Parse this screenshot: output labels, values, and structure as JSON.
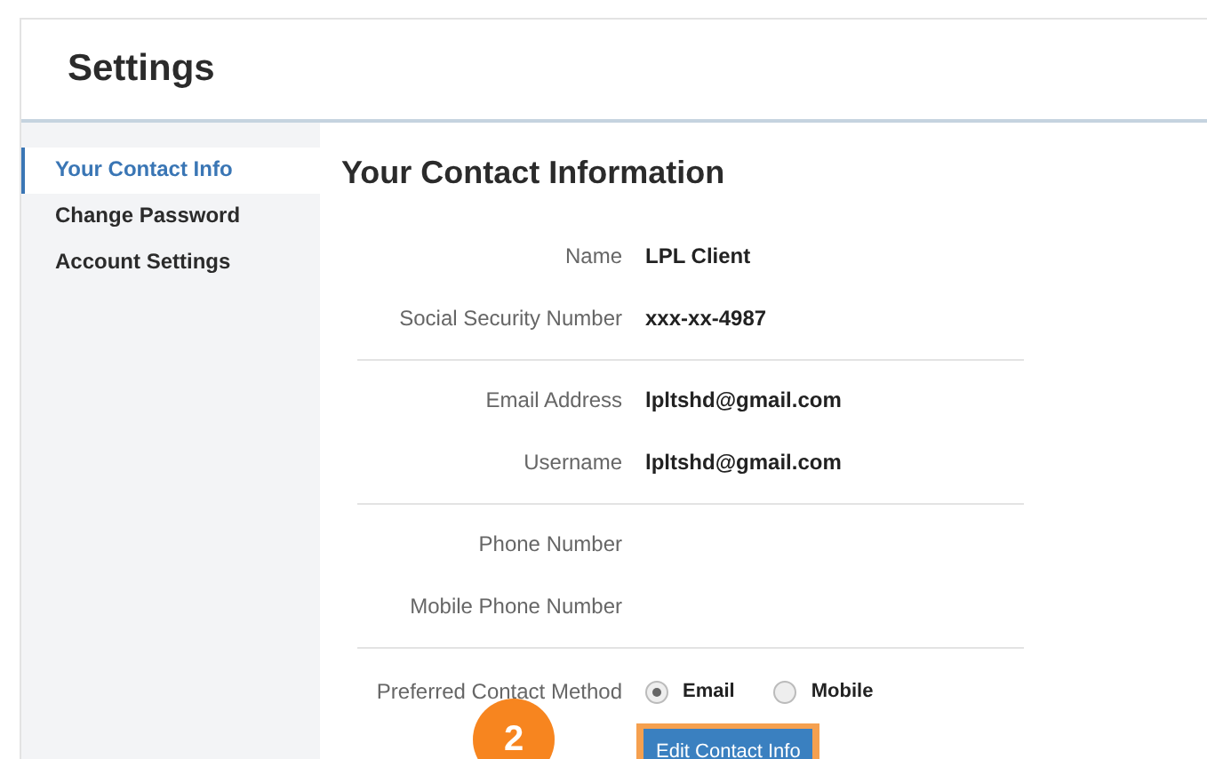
{
  "header": {
    "title": "Settings"
  },
  "sidebar": {
    "items": [
      {
        "label": "Your Contact Info",
        "selected": true
      },
      {
        "label": "Change Password",
        "selected": false
      },
      {
        "label": "Account Settings",
        "selected": false
      }
    ]
  },
  "content": {
    "title": "Your Contact Information",
    "groups": [
      [
        {
          "label": "Name",
          "value": "LPL Client"
        },
        {
          "label": "Social Security Number",
          "value": "xxx-xx-4987"
        }
      ],
      [
        {
          "label": "Email Address",
          "value": "lpltshd@gmail.com"
        },
        {
          "label": "Username",
          "value": "lpltshd@gmail.com"
        }
      ],
      [
        {
          "label": "Phone Number"
        },
        {
          "label": "Mobile Phone Number"
        }
      ]
    ],
    "preferred_contact": {
      "label": "Preferred Contact Method",
      "options": [
        {
          "label": "Email",
          "selected": true
        },
        {
          "label": "Mobile",
          "selected": false
        }
      ]
    },
    "edit_button": {
      "label": "Edit Contact Info",
      "highlighted": true
    },
    "step_badge": "2"
  }
}
